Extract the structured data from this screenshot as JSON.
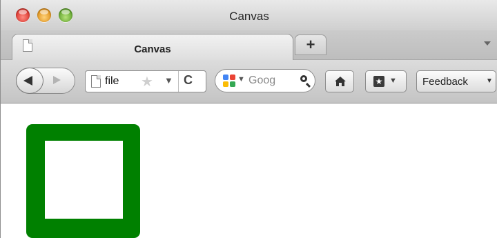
{
  "window": {
    "title": "Canvas"
  },
  "tabs": [
    {
      "label": "Canvas"
    }
  ],
  "tabstrip": {
    "new_tab_label": "+"
  },
  "navbar": {
    "url": "file",
    "search_text": "Goog",
    "feedback_label": "Feedback"
  },
  "icons": {
    "back": "back-arrow-icon",
    "forward": "forward-arrow-icon",
    "page": "page-icon",
    "star": "star-icon",
    "reload": "reload-icon",
    "search_engine": "google-icon",
    "search": "magnifier-icon",
    "home": "home-icon",
    "bookmarks": "bookmark-icon"
  },
  "content": {
    "shape": "square-outline",
    "stroke_color": "#008000",
    "fill_color": "#ffffff"
  }
}
